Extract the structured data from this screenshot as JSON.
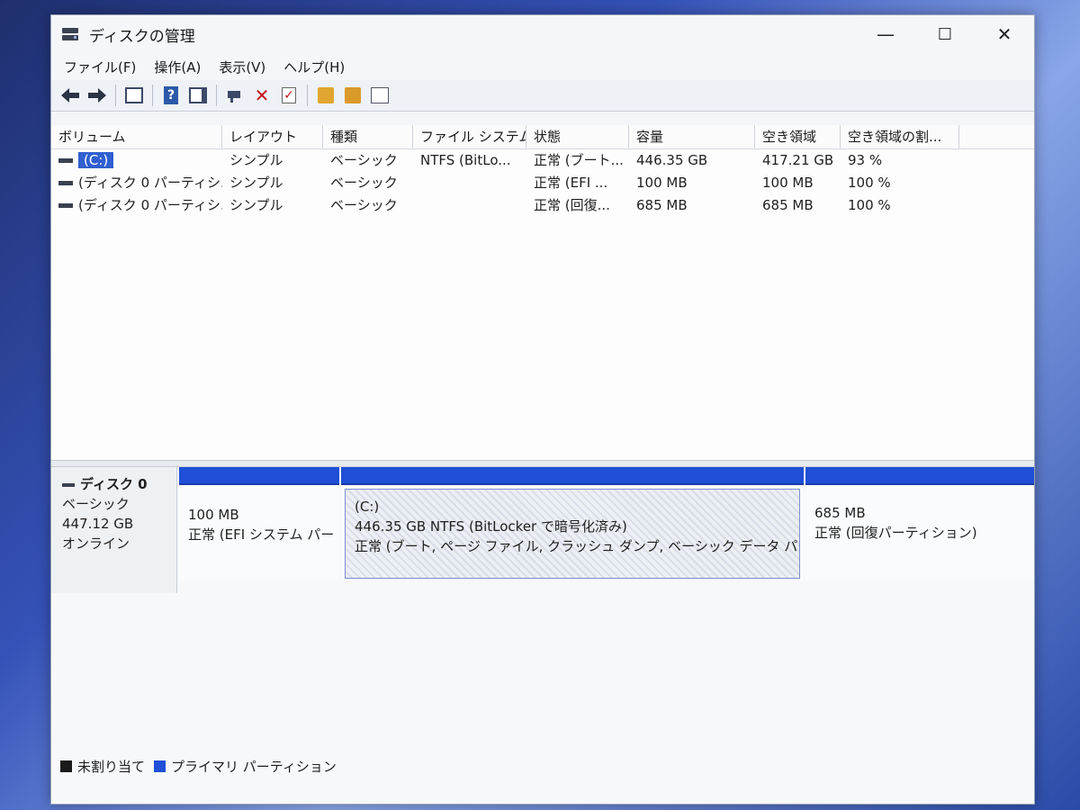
{
  "window": {
    "title": "ディスクの管理"
  },
  "window_controls": {
    "minimize": "—",
    "maximize": "☐",
    "close": "✕"
  },
  "menu": [
    "ファイル(F)",
    "操作(A)",
    "表示(V)",
    "ヘルプ(H)"
  ],
  "toolbar": {
    "icons": [
      "back-arrow-icon",
      "forward-arrow-icon",
      "console-tree-icon",
      "help-icon",
      "action-pane-icon",
      "connect-icon",
      "delete-icon",
      "properties-icon",
      "folder-up-icon",
      "folder-search-icon",
      "details-view-icon"
    ],
    "delete_glyph": "✕",
    "help_glyph": "?"
  },
  "volume_list": {
    "columns": [
      "ボリューム",
      "レイアウト",
      "種類",
      "ファイル システム",
      "状態",
      "容量",
      "空き領域",
      "空き領域の割..."
    ],
    "rows": [
      {
        "volume": "(C:)",
        "layout": "シンプル",
        "type": "ベーシック",
        "fs": "NTFS (BitLo...",
        "status": "正常 (ブート...",
        "capacity": "446.35 GB",
        "free": "417.21 GB",
        "pct": "93 %"
      },
      {
        "volume": "(ディスク 0 パーティシ...",
        "layout": "シンプル",
        "type": "ベーシック",
        "fs": "",
        "status": "正常 (EFI ...",
        "capacity": "100 MB",
        "free": "100 MB",
        "pct": "100 %"
      },
      {
        "volume": "(ディスク 0 パーティシ...",
        "layout": "シンプル",
        "type": "ベーシック",
        "fs": "",
        "status": "正常 (回復...",
        "capacity": "685 MB",
        "free": "685 MB",
        "pct": "100 %"
      }
    ]
  },
  "disk0": {
    "name": "ディスク 0",
    "type": "ベーシック",
    "size": "447.12 GB",
    "status": "オンライン",
    "partitions": [
      {
        "line1": "",
        "line2": "100 MB",
        "line3": "正常 (EFI システム パー"
      },
      {
        "line1": "(C:)",
        "line2": "446.35 GB NTFS (BitLocker で暗号化済み)",
        "line3": "正常 (ブート, ページ ファイル, クラッシュ ダンプ, ベーシック データ パーティシ"
      },
      {
        "line1": "",
        "line2": "685 MB",
        "line3": "正常 (回復パーティション)"
      }
    ]
  },
  "legend": [
    {
      "label": "未割り当て",
      "color": "#1a1a1a"
    },
    {
      "label": "プライマリ パーティション",
      "color": "#1f4fd6"
    }
  ]
}
